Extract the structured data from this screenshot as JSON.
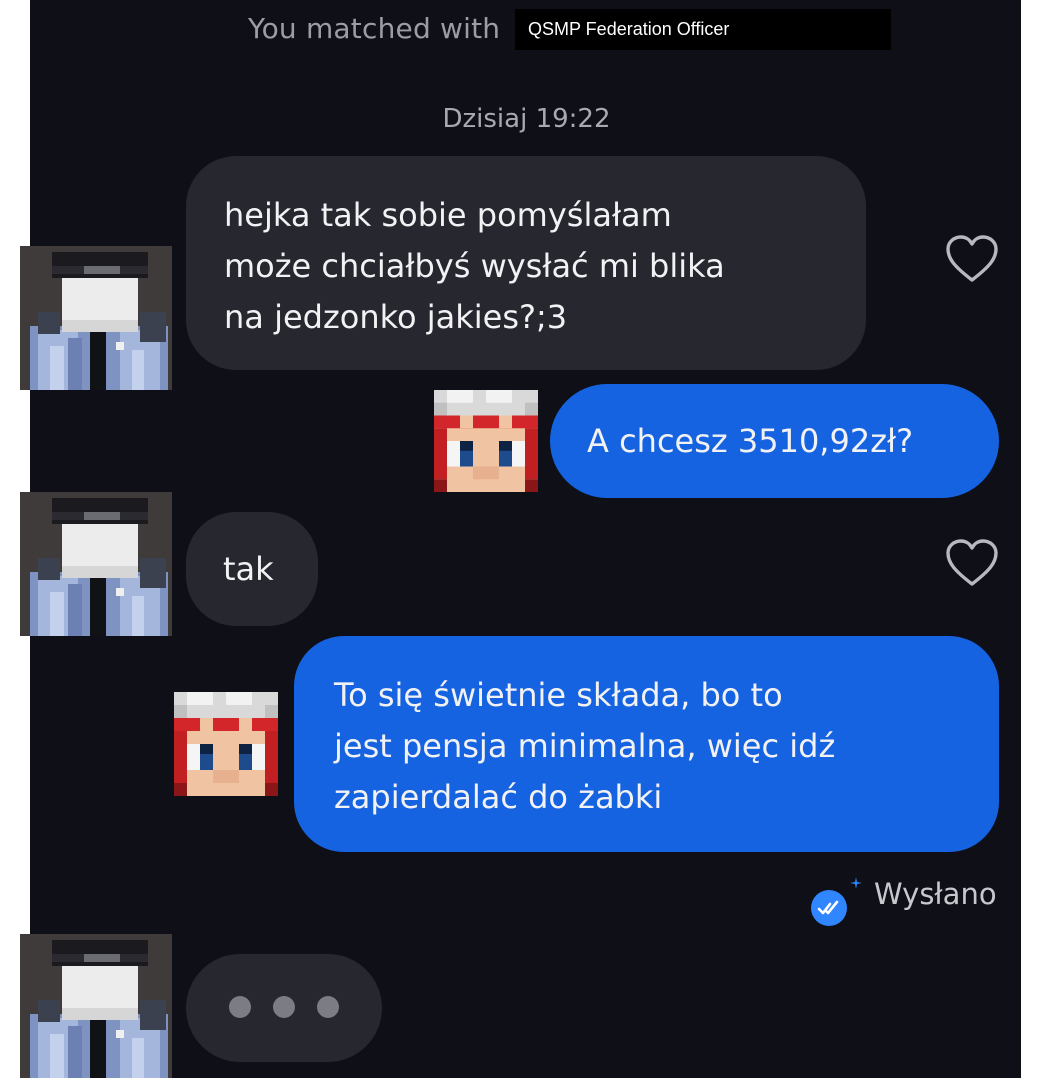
{
  "header": {
    "matched_prefix": "You matched with",
    "matched_name": "QSMP Federation Officer"
  },
  "conversation": {
    "timestamp": "Dzisiaj 19:22",
    "messages": [
      {
        "from": "them",
        "lines": [
          "hejka tak sobie pomyślałam",
          "może chciałbyś wysłać mi blika",
          "na jedzonko jakies?;3"
        ]
      },
      {
        "from": "me",
        "lines": [
          "A chcesz 3510,92zł?"
        ]
      },
      {
        "from": "them",
        "lines": [
          "tak"
        ]
      },
      {
        "from": "me",
        "lines": [
          "To się świetnie składa, bo to",
          "jest pensja minimalna, więc idź",
          "zapierdalać do żabki"
        ]
      }
    ],
    "delivery_status": "Wysłano",
    "typing_indicator": "typing-dots"
  },
  "icons": {
    "like": "heart-outline-icon",
    "status": "double-check-icon",
    "avatar_them": "blocky-officer-avatar",
    "avatar_me": "pixel-face-avatar"
  },
  "colors": {
    "background": "#0f1017",
    "incoming_bubble": "#26272f",
    "outgoing_bubble": "#1563e0",
    "status_icon": "#2f86ff",
    "text": "#f2f2f4",
    "muted_text": "#9c9da4"
  }
}
